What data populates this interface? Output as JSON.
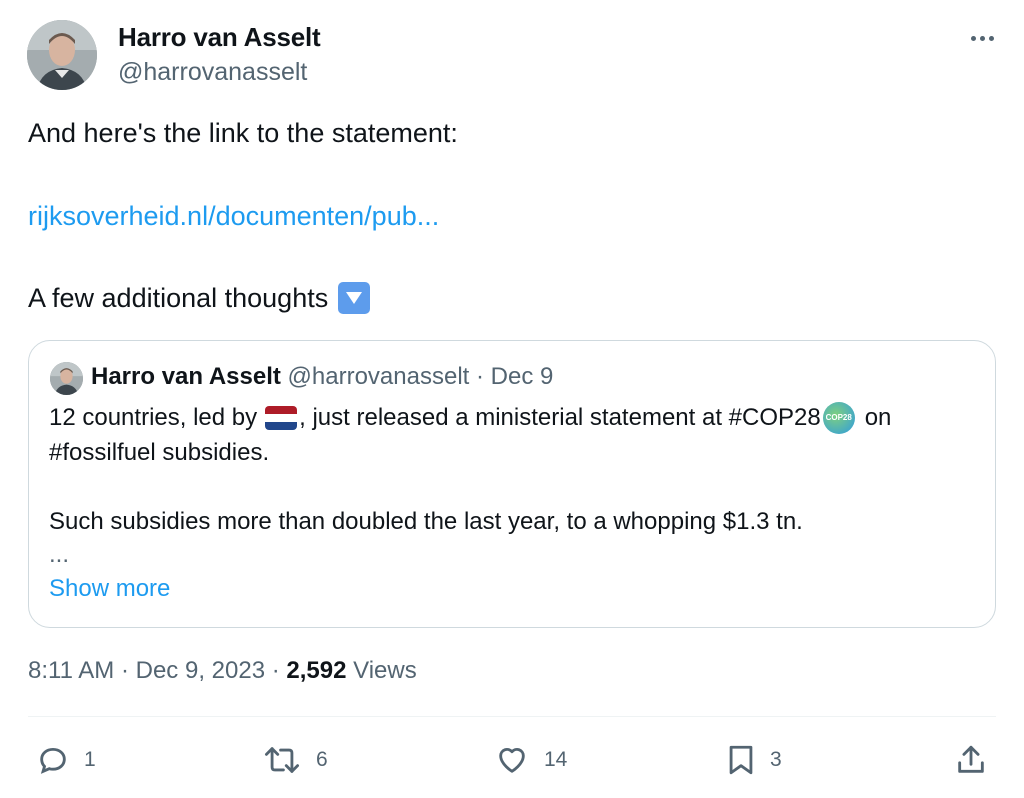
{
  "author": {
    "name": "Harro van Asselt",
    "handle": "@harrovanasselt"
  },
  "tweet": {
    "line1": "And here's the link to the statement:",
    "link": "rijksoverheid.nl/documenten/pub...",
    "line3": "A few additional thoughts",
    "line3_emoji": "down-arrow-button-emoji"
  },
  "quote": {
    "name": "Harro van Asselt",
    "handle": "@harrovanasselt",
    "separator": "·",
    "date": "Dec 9",
    "text1_before_flag": "12 countries, led by",
    "flag_icon": "netherlands-flag-icon",
    "text1_after_flag": ", just released a ministerial statement at #COP28",
    "cop_badge": "COP28",
    "text1_end": "on",
    "text2": "#fossilfuel subsidies.",
    "text3": "Such subsidies more than doubled the last year, to a whopping $1.3 tn.",
    "ellipsis": "...",
    "show_more": "Show more"
  },
  "meta": {
    "time": "8:11 AM",
    "sep1": "·",
    "date": "Dec 9, 2023",
    "sep2": "·",
    "views_count": "2,592",
    "views_label": "Views"
  },
  "actions": {
    "replies": "1",
    "reposts": "6",
    "likes": "14",
    "bookmarks": "3"
  },
  "colors": {
    "link": "#1d9bf0",
    "secondary_text": "#536471",
    "border": "#cfd9de"
  }
}
